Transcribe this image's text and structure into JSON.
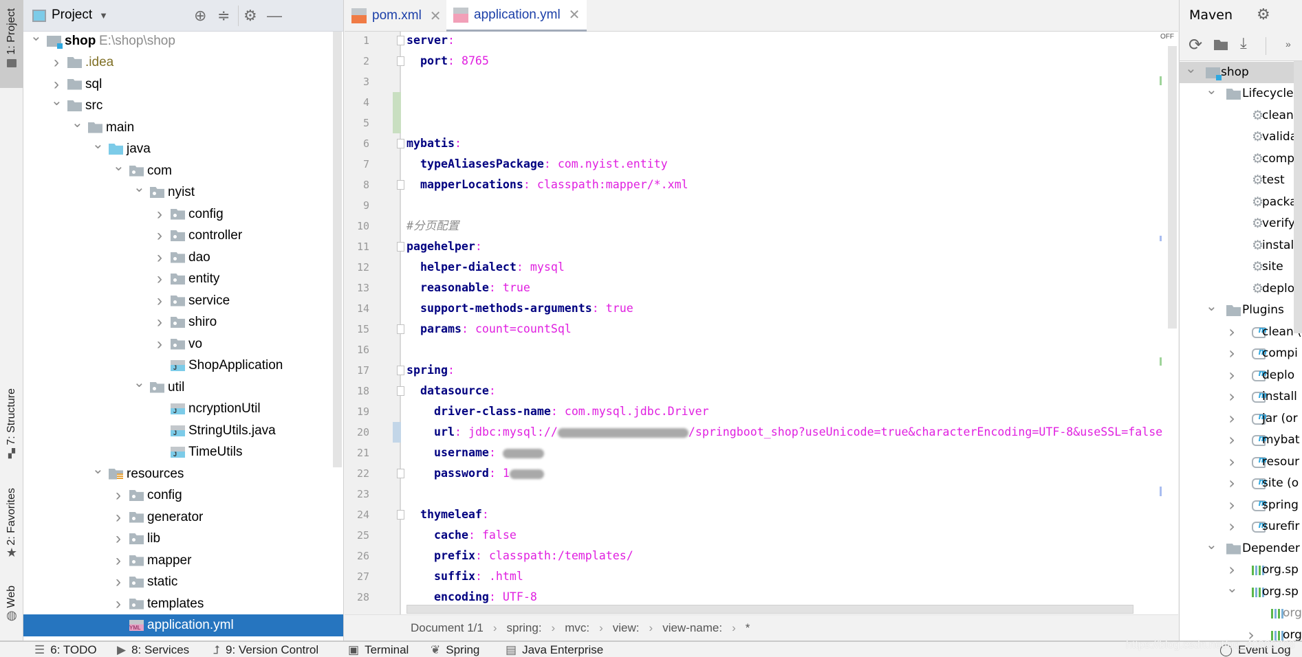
{
  "left_strip": {
    "project_tab": "1: Project",
    "structure_tab": "7: Structure",
    "favorites_tab": "2: Favorites",
    "web_tab": "Web"
  },
  "project_panel": {
    "title": "Project",
    "tree": [
      {
        "label": "shop",
        "extra": "E:\\shop\\shop",
        "level": 0,
        "chevron": "down",
        "icon": "module",
        "bold": true
      },
      {
        "label": ".idea",
        "level": 1,
        "chevron": "right",
        "icon": "folder",
        "color": "olive"
      },
      {
        "label": "sql",
        "level": 1,
        "chevron": "right",
        "icon": "folder"
      },
      {
        "label": "src",
        "level": 1,
        "chevron": "down",
        "icon": "folder"
      },
      {
        "label": "main",
        "level": 2,
        "chevron": "down",
        "icon": "folder"
      },
      {
        "label": "java",
        "level": 3,
        "chevron": "down",
        "icon": "srcf"
      },
      {
        "label": "com",
        "level": 4,
        "chevron": "down",
        "icon": "pkg"
      },
      {
        "label": "nyist",
        "level": 5,
        "chevron": "down",
        "icon": "pkg"
      },
      {
        "label": "config",
        "level": 6,
        "chevron": "right",
        "icon": "pkg"
      },
      {
        "label": "controller",
        "level": 6,
        "chevron": "right",
        "icon": "pkg"
      },
      {
        "label": "dao",
        "level": 6,
        "chevron": "right",
        "icon": "pkg"
      },
      {
        "label": "entity",
        "level": 6,
        "chevron": "right",
        "icon": "pkg"
      },
      {
        "label": "service",
        "level": 6,
        "chevron": "right",
        "icon": "pkg"
      },
      {
        "label": "shiro",
        "level": 6,
        "chevron": "right",
        "icon": "pkg"
      },
      {
        "label": "vo",
        "level": 6,
        "chevron": "right",
        "icon": "pkg"
      },
      {
        "label": "ShopApplication",
        "level": 6,
        "chevron": "",
        "icon": "jfile"
      },
      {
        "label": "util",
        "level": 5,
        "chevron": "down",
        "icon": "pkg"
      },
      {
        "label": "ncryptionUtil",
        "level": 6,
        "chevron": "",
        "icon": "jfile"
      },
      {
        "label": "StringUtils.java",
        "level": 6,
        "chevron": "",
        "icon": "jfile"
      },
      {
        "label": "TimeUtils",
        "level": 6,
        "chevron": "",
        "icon": "jfile"
      },
      {
        "label": "resources",
        "level": 3,
        "chevron": "down",
        "icon": "resf"
      },
      {
        "label": "config",
        "level": 4,
        "chevron": "right",
        "icon": "pkg"
      },
      {
        "label": "generator",
        "level": 4,
        "chevron": "right",
        "icon": "pkg"
      },
      {
        "label": "lib",
        "level": 4,
        "chevron": "right",
        "icon": "pkg"
      },
      {
        "label": "mapper",
        "level": 4,
        "chevron": "right",
        "icon": "pkg"
      },
      {
        "label": "static",
        "level": 4,
        "chevron": "right",
        "icon": "pkg"
      },
      {
        "label": "templates",
        "level": 4,
        "chevron": "right",
        "icon": "pkg"
      },
      {
        "label": "application.yml",
        "level": 4,
        "chevron": "",
        "icon": "yfile",
        "selected": true
      }
    ]
  },
  "editor": {
    "tabs": [
      {
        "label": "pom.xml",
        "icon": "xml-file-icon",
        "active": false
      },
      {
        "label": "application.yml",
        "icon": "yml-file-icon",
        "active": true
      }
    ],
    "inspection_status": "OFF",
    "lines": [
      {
        "n": "1",
        "indent": 0,
        "key": "server",
        "fold": true
      },
      {
        "n": "2",
        "indent": 2,
        "key": "port",
        "value": "8765",
        "fold": true
      },
      {
        "n": "3"
      },
      {
        "n": "4"
      },
      {
        "n": "5"
      },
      {
        "n": "6",
        "indent": 0,
        "key": "mybatis",
        "fold": true
      },
      {
        "n": "7",
        "indent": 2,
        "key": "typeAliasesPackage",
        "value": "com.nyist.entity"
      },
      {
        "n": "8",
        "indent": 2,
        "key": "mapperLocations",
        "value": "classpath:mapper/*.xml",
        "fold": true
      },
      {
        "n": "9"
      },
      {
        "n": "10",
        "indent": 0,
        "comment": "#分页配置"
      },
      {
        "n": "11",
        "indent": 0,
        "key": "pagehelper",
        "fold": true
      },
      {
        "n": "12",
        "indent": 2,
        "key": "helper-dialect",
        "value": "mysql"
      },
      {
        "n": "13",
        "indent": 2,
        "key": "reasonable",
        "value": "true"
      },
      {
        "n": "14",
        "indent": 2,
        "key": "support-methods-arguments",
        "value": "true"
      },
      {
        "n": "15",
        "indent": 2,
        "key": "params",
        "value": "count=countSql",
        "fold": true
      },
      {
        "n": "16"
      },
      {
        "n": "17",
        "indent": 0,
        "key": "spring",
        "fold": true
      },
      {
        "n": "18",
        "indent": 2,
        "key": "datasource",
        "fold": true
      },
      {
        "n": "19",
        "indent": 4,
        "key": "driver-class-name",
        "value": "com.mysql.jdbc.Driver"
      },
      {
        "n": "20",
        "indent": 4,
        "key": "url",
        "value": "jdbc:mysql://",
        "redact_chars": 19,
        "value_after": "/springboot_shop?useUnicode=true&characterEncoding=UTF-8&useSSL=false"
      },
      {
        "n": "21",
        "indent": 4,
        "key": "username",
        "value": "",
        "redact_chars": 6
      },
      {
        "n": "22",
        "indent": 4,
        "key": "password",
        "value": "1",
        "redact_chars": 5,
        "fold": true
      },
      {
        "n": "23"
      },
      {
        "n": "24",
        "indent": 2,
        "key": "thymeleaf",
        "fold": true
      },
      {
        "n": "25",
        "indent": 4,
        "key": "cache",
        "value": "false"
      },
      {
        "n": "26",
        "indent": 4,
        "key": "prefix",
        "value": "classpath:/templates/"
      },
      {
        "n": "27",
        "indent": 4,
        "key": "suffix",
        "value": ".html"
      },
      {
        "n": "28",
        "indent": 4,
        "key": "encoding",
        "value": "UTF-8"
      }
    ],
    "breadcrumb": [
      "Document 1/1",
      "spring:",
      "mvc:",
      "view:",
      "view-name:",
      "*"
    ],
    "colors": {
      "key": "#000080",
      "value": "#e020e0",
      "comment": "#8c8c8c",
      "added": "#c9dfc1",
      "modified": "#c3d6e8"
    }
  },
  "maven": {
    "title": "Maven",
    "tree": [
      {
        "label": "shop",
        "level": 0,
        "chevron": "down",
        "icon": "module",
        "highlight": true
      },
      {
        "label": "Lifecycle",
        "level": 1,
        "chevron": "down",
        "icon": "folder"
      },
      {
        "label": "clean",
        "level": 2,
        "icon": "gear"
      },
      {
        "label": "validat",
        "level": 2,
        "icon": "gear"
      },
      {
        "label": "compi",
        "level": 2,
        "icon": "gear"
      },
      {
        "label": "test",
        "level": 2,
        "icon": "gear"
      },
      {
        "label": "packa",
        "level": 2,
        "icon": "gear"
      },
      {
        "label": "verify",
        "level": 2,
        "icon": "gear"
      },
      {
        "label": "install",
        "level": 2,
        "icon": "gear"
      },
      {
        "label": "site",
        "level": 2,
        "icon": "gear"
      },
      {
        "label": "deplo",
        "level": 2,
        "icon": "gear"
      },
      {
        "label": "Plugins",
        "level": 1,
        "chevron": "down",
        "icon": "folder"
      },
      {
        "label": "clean (",
        "level": 2,
        "chevron": "right",
        "icon": "plugin"
      },
      {
        "label": "compi",
        "level": 2,
        "chevron": "right",
        "icon": "plugin"
      },
      {
        "label": "deplo",
        "level": 2,
        "chevron": "right",
        "icon": "plugin"
      },
      {
        "label": "install",
        "level": 2,
        "chevron": "right",
        "icon": "plugin"
      },
      {
        "label": "jar (or",
        "level": 2,
        "chevron": "right",
        "icon": "plugin"
      },
      {
        "label": "mybat",
        "level": 2,
        "chevron": "right",
        "icon": "plugin"
      },
      {
        "label": "resour",
        "level": 2,
        "chevron": "right",
        "icon": "plugin"
      },
      {
        "label": "site (o",
        "level": 2,
        "chevron": "right",
        "icon": "plugin"
      },
      {
        "label": "spring",
        "level": 2,
        "chevron": "right",
        "icon": "plugin"
      },
      {
        "label": "surefir",
        "level": 2,
        "chevron": "right",
        "icon": "plugin"
      },
      {
        "label": "Depender",
        "level": 1,
        "chevron": "down",
        "icon": "folder"
      },
      {
        "label": "org.sp",
        "level": 2,
        "chevron": "right",
        "icon": "deps"
      },
      {
        "label": "org.sp",
        "level": 2,
        "chevron": "down",
        "icon": "deps"
      },
      {
        "label": "org",
        "level": 3,
        "icon": "deps",
        "dim": true
      },
      {
        "label": "org",
        "level": 3,
        "chevron": "right",
        "icon": "deps"
      }
    ]
  },
  "bottom_bar": {
    "todo": "6: TODO",
    "services": "8: Services",
    "vcs": "9: Version Control",
    "terminal": "Terminal",
    "spring": "Spring",
    "java_enterprise": "Java Enterprise",
    "event_log": "Event Log"
  },
  "watermark": "https://blog.csdn.net/qq_40985788"
}
